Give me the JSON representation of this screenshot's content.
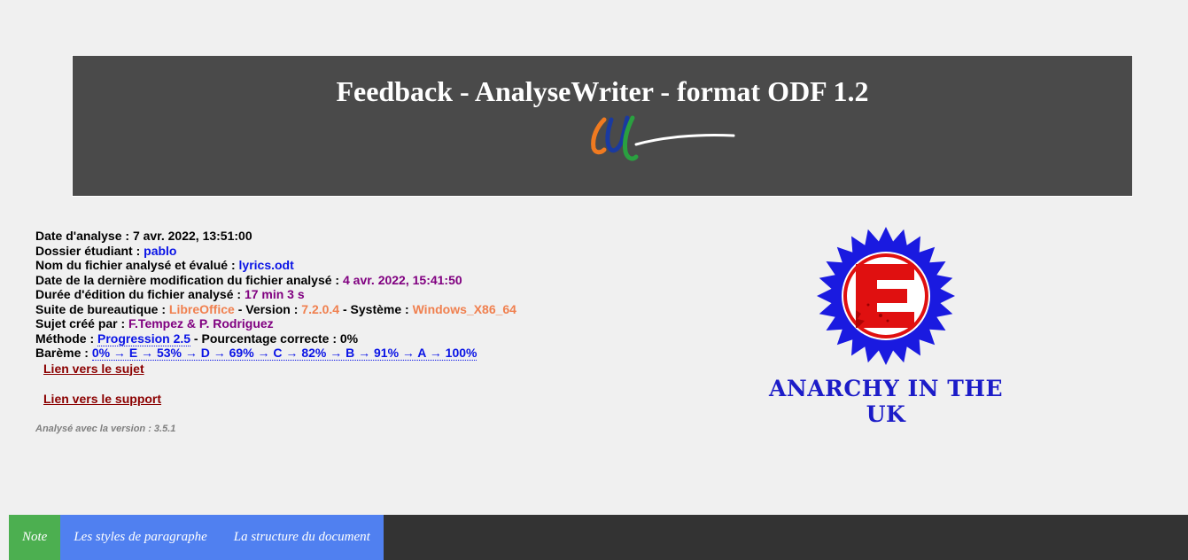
{
  "header": {
    "title": "Feedback - AnalyseWriter - format ODF 1.2"
  },
  "info": {
    "date_label": "Date d'analyse : ",
    "date_value": "7 avr. 2022, 13:51:00",
    "folder_label": "Dossier étudiant : ",
    "folder_value": "pablo",
    "file_label": "Nom du fichier analysé et évalué : ",
    "file_value": "lyrics.odt",
    "modified_label": "Date de la dernière modification du fichier analysé : ",
    "modified_value": "4 avr. 2022, 15:41:50",
    "duration_label": "Durée d'édition du fichier analysé : ",
    "duration_value": "17 min 3 s",
    "suite_label": "Suite de bureautique : ",
    "suite_value": "LibreOffice",
    "version_label": " - Version : ",
    "version_value": "7.2.0.4",
    "system_label": " - Système : ",
    "system_value": "Windows_X86_64",
    "author_label": "Sujet créé par : ",
    "author_value": "F.Tempez & P. Rodriguez",
    "method_label": "Méthode : ",
    "method_value": "Progression 2.5",
    "percent_label": " - Pourcentage correcte : ",
    "percent_value": "0%",
    "scale_label": "Barème : ",
    "scale_value": "0% → E → 53% → D → 69% → C → 82% → B → 91% → A → 100%"
  },
  "links": {
    "subject": "Lien vers le sujet",
    "support": "Lien vers le support"
  },
  "analyzer_version": "Analysé avec la version : 3.5.1",
  "grade": {
    "letter": "E",
    "caption": "ANARCHY IN THE UK"
  },
  "tabs": [
    {
      "label": "Note"
    },
    {
      "label": "Les styles de paragraphe"
    },
    {
      "label": "La structure du document"
    }
  ],
  "colors": {
    "header_bg": "#4a4a4a",
    "tab_active": "#4caf50",
    "tab_inactive": "#5080f0",
    "link": "#8b0000",
    "value_blue": "#0a14e6",
    "value_purple": "#800080",
    "value_orange": "#f0804f",
    "badge_blue": "#1a1ae0",
    "badge_red": "#e01010"
  }
}
